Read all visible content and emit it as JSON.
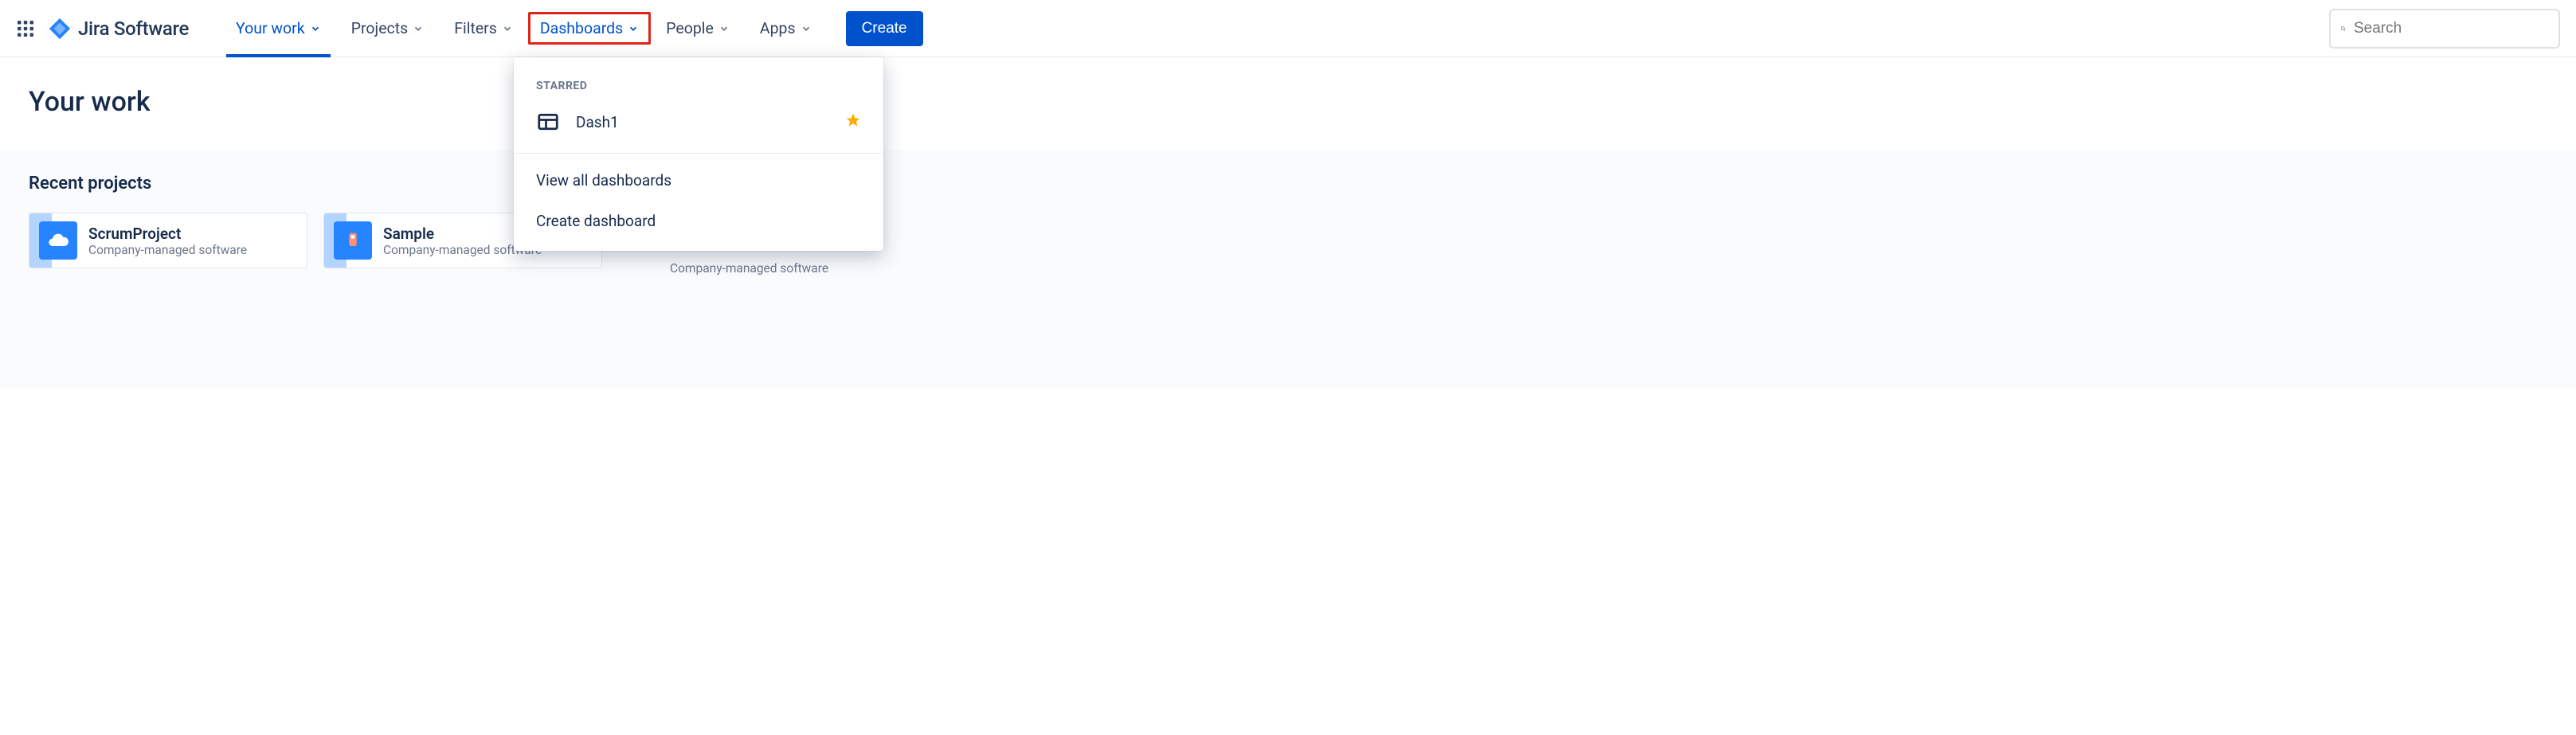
{
  "header": {
    "product_name": "Jira Software",
    "nav": {
      "your_work": "Your work",
      "projects": "Projects",
      "filters": "Filters",
      "dashboards": "Dashboards",
      "people": "People",
      "apps": "Apps"
    },
    "create_label": "Create",
    "search_placeholder": "Search"
  },
  "dashboards_dropdown": {
    "starred_header": "STARRED",
    "starred_items": [
      {
        "label": "Dash1"
      }
    ],
    "view_all": "View all dashboards",
    "create": "Create dashboard"
  },
  "page": {
    "title": "Your work",
    "recent_projects_heading": "Recent projects",
    "projects": [
      {
        "name": "ScrumProject",
        "description": "Company-managed software",
        "icon_bg": "#2684FF"
      },
      {
        "name": "Sample",
        "description": "Company-managed software",
        "icon_bg": "#2684FF"
      }
    ],
    "ghost_description": "Company-managed software"
  }
}
